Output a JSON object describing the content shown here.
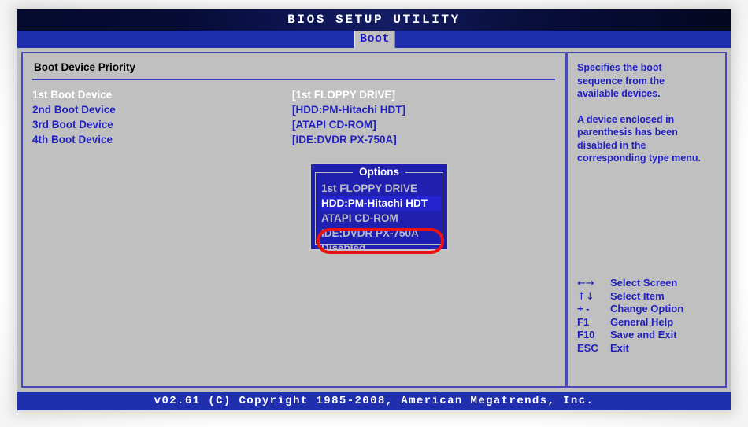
{
  "titlebar": {
    "title": "BIOS SETUP UTILITY"
  },
  "menubar": {
    "active_tab": "Boot"
  },
  "main": {
    "section_title": "Boot Device Priority",
    "rows": [
      {
        "label": "1st Boot Device",
        "value": "[1st FLOPPY DRIVE]",
        "selected": true
      },
      {
        "label": "2nd Boot Device",
        "value": "[HDD:PM-Hitachi HDT]",
        "selected": false
      },
      {
        "label": "3rd Boot Device",
        "value": "[ATAPI CD-ROM]",
        "selected": false
      },
      {
        "label": "4th Boot Device",
        "value": "[IDE:DVDR PX-750A]",
        "selected": false
      }
    ]
  },
  "options_popup": {
    "title": "Options",
    "items": [
      {
        "label": "1st FLOPPY DRIVE",
        "selected": false
      },
      {
        "label": "HDD:PM-Hitachi HDT",
        "selected": true
      },
      {
        "label": "ATAPI CD-ROM",
        "selected": false
      },
      {
        "label": "IDE:DVDR PX-750A",
        "selected": false
      },
      {
        "label": "Disabled",
        "selected": false
      }
    ]
  },
  "annotation": {
    "shape": "red-oval",
    "color": "#ee1111",
    "targets": "HDD:PM-Hitachi HDT"
  },
  "help": {
    "paragraph1": "Specifies the boot sequence from the available devices.",
    "paragraph2": "A device enclosed in parenthesis has been disabled in the corresponding type menu."
  },
  "key_legend": [
    {
      "key": "←→",
      "desc": "Select Screen",
      "symbol": true
    },
    {
      "key": "↑↓",
      "desc": "Select Item",
      "symbol": true
    },
    {
      "key": "+ -",
      "desc": "Change Option",
      "symbol": false
    },
    {
      "key": "F1",
      "desc": "General Help",
      "symbol": false
    },
    {
      "key": "F10",
      "desc": "Save and Exit",
      "symbol": false
    },
    {
      "key": "ESC",
      "desc": "Exit",
      "symbol": false
    }
  ],
  "footer": {
    "text": "v02.61 (C) Copyright 1985-2008, American Megatrends, Inc."
  },
  "colors": {
    "screen_bg": "#c0c0c0",
    "accent_blue": "#1f1fc0",
    "bar_blue": "#1f2fae",
    "title_navy": "#050a2e",
    "popup_blue": "#1f1fb0",
    "annotation_red": "#ee1111",
    "selected_text": "#ffffff"
  }
}
